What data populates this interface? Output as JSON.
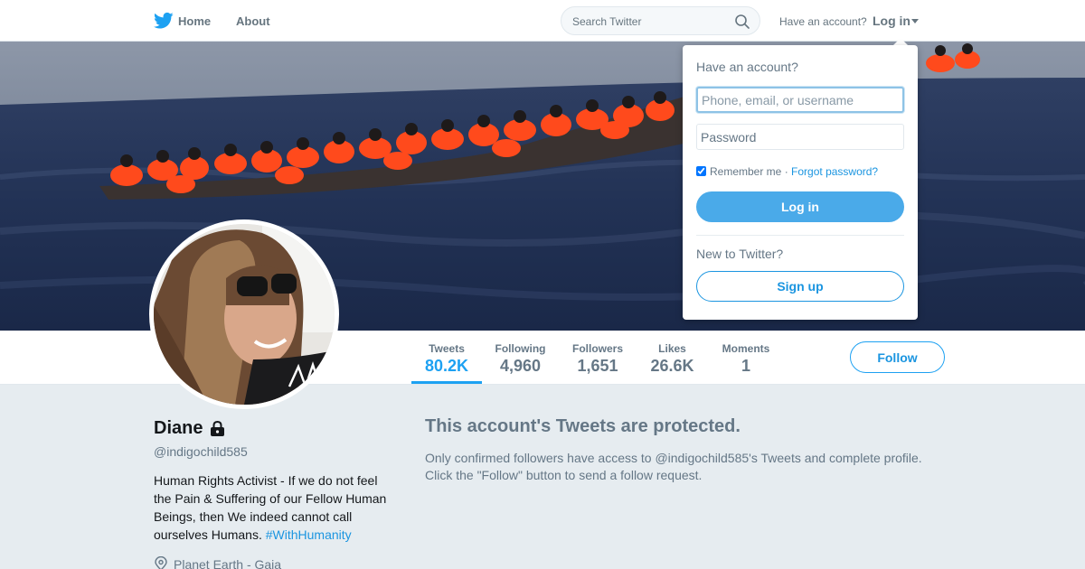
{
  "nav": {
    "home_label": "Home",
    "about_label": "About",
    "search_placeholder": "Search Twitter",
    "have_account_label": "Have an account?",
    "login_label": "Log in",
    "brand_color": "#1da1f2"
  },
  "profile_nav": {
    "stats": [
      {
        "label": "Tweets",
        "value": "80.2K",
        "active": true
      },
      {
        "label": "Following",
        "value": "4,960"
      },
      {
        "label": "Followers",
        "value": "1,651"
      },
      {
        "label": "Likes",
        "value": "26.6K"
      },
      {
        "label": "Moments",
        "value": "1"
      }
    ],
    "follow_label": "Follow"
  },
  "profile": {
    "name": "Diane",
    "handle": "@indigochild585",
    "bio_text": "Human Rights Activist - If we do not feel the Pain & Suffering of our Fellow Human Beings, then We indeed cannot call ourselves Humans.",
    "bio_hashtag": "#WithHumanity",
    "location": "Planet Earth - Gaia"
  },
  "protected": {
    "title": "This account's Tweets are protected.",
    "line1": "Only confirmed followers have access to @indigochild585's Tweets and complete profile.",
    "line2": "Click the \"Follow\" button to send a follow request."
  },
  "login_dropdown": {
    "heading": "Have an account?",
    "username_placeholder": "Phone, email, or username",
    "password_placeholder": "Password",
    "remember_label": "Remember me",
    "separator": "·",
    "forgot_label": "Forgot password?",
    "login_button": "Log in",
    "new_to_label": "New to Twitter?",
    "signup_button": "Sign up"
  }
}
